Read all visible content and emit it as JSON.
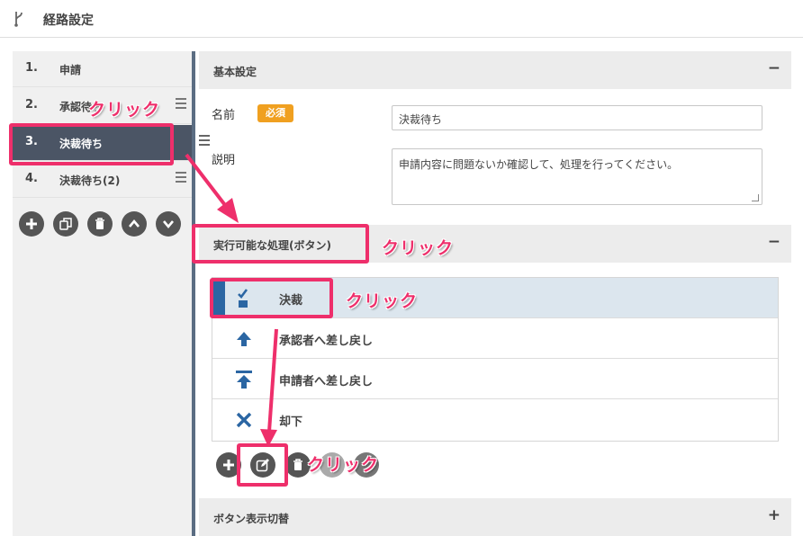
{
  "header": {
    "title": "経路設定"
  },
  "steps": [
    {
      "num": "1.",
      "label": "申請"
    },
    {
      "num": "2.",
      "label": "承認待ち"
    },
    {
      "num": "3.",
      "label": "決裁待ち"
    },
    {
      "num": "4.",
      "label": "決裁待ち(2)"
    }
  ],
  "basic": {
    "header": "基本設定",
    "toggle": "−",
    "name_label": "名前",
    "required": "必須",
    "name_value": "決裁待ち",
    "desc_label": "説明",
    "desc_value": "申請内容に問題ないか確認して、処理を行ってください。"
  },
  "actions": {
    "header": "実行可能な処理(ボタン)",
    "toggle": "−",
    "items": [
      {
        "label": "決裁",
        "icon": "check-icon"
      },
      {
        "label": "承認者へ差し戻し",
        "icon": "arrow-up-icon"
      },
      {
        "label": "申請者へ差し戻し",
        "icon": "arrow-up-to-top-icon"
      },
      {
        "label": "却下",
        "icon": "close-icon"
      }
    ]
  },
  "display": {
    "header": "ボタン表示切替",
    "toggle": "+"
  },
  "annotations": {
    "click": "クリック"
  },
  "colors": {
    "accent": "#ee2f6b",
    "active_step": "#4b5565",
    "required": "#f0a020",
    "action_icon": "#2b66a3"
  }
}
